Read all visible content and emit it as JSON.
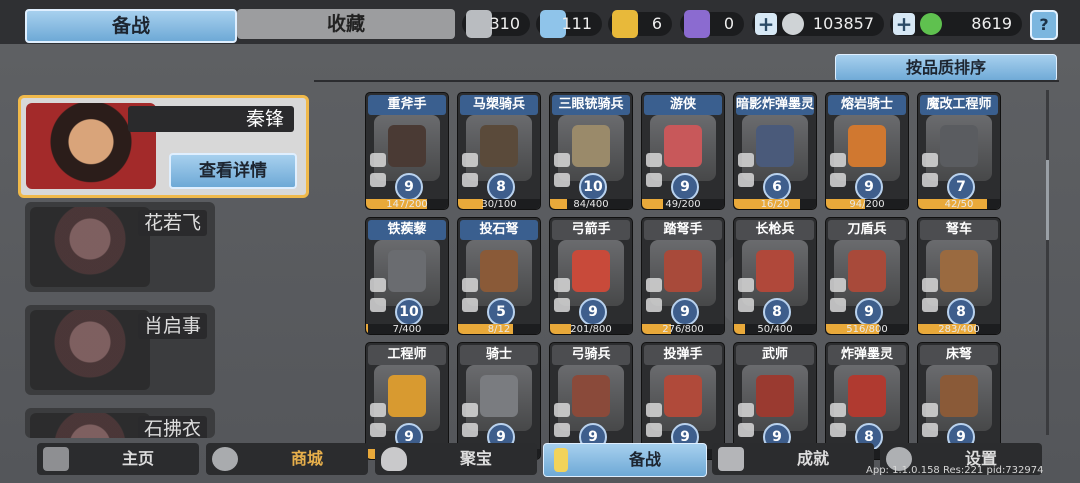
{
  "tabs": [
    {
      "label": "备战",
      "active": true
    },
    {
      "label": "收藏",
      "active": false
    }
  ],
  "resources": [
    {
      "icon": "silver-shield-icon",
      "value": "310",
      "color": "#b9bcc0"
    },
    {
      "icon": "crystal-icon",
      "value": "111",
      "color": "#8fc4ea"
    },
    {
      "icon": "gold-badge-icon",
      "value": "6",
      "color": "#e8b93a"
    },
    {
      "icon": "purple-badge-icon",
      "value": "0",
      "color": "#8b6bd0"
    },
    {
      "icon": "silver-coin-icon",
      "value": "103857",
      "color": "#cfd3d6"
    },
    {
      "icon": "green-gem-icon",
      "value": "8619",
      "color": "#5fc14f"
    }
  ],
  "help_label": "?",
  "sort_label": "按品质排序",
  "heroes": [
    {
      "name": "秦锋",
      "selected": true,
      "detail_label": "查看详情"
    },
    {
      "name": "花若飞"
    },
    {
      "name": "肖启事"
    },
    {
      "name": "石拂衣"
    }
  ],
  "units": [
    {
      "name": "重斧手",
      "level": "9",
      "progress": "147/200",
      "ratio": 0.735,
      "quality": "blue",
      "color": "#4a3a34"
    },
    {
      "name": "马槊骑兵",
      "level": "8",
      "progress": "30/100",
      "ratio": 0.3,
      "quality": "blue",
      "color": "#5a4a3a"
    },
    {
      "name": "三眼铳骑兵",
      "level": "10",
      "progress": "84/400",
      "ratio": 0.21,
      "quality": "blue",
      "color": "#9a8a6a"
    },
    {
      "name": "游侠",
      "level": "9",
      "progress": "49/200",
      "ratio": 0.245,
      "quality": "blue",
      "color": "#c8585a"
    },
    {
      "name": "暗影炸弹墨灵",
      "level": "6",
      "progress": "16/20",
      "ratio": 0.8,
      "quality": "blue",
      "color": "#4a5a7a"
    },
    {
      "name": "熔岩骑士",
      "level": "9",
      "progress": "94/200",
      "ratio": 0.47,
      "quality": "blue",
      "color": "#d07830"
    },
    {
      "name": "魔改工程师",
      "level": "7",
      "progress": "42/50",
      "ratio": 0.84,
      "quality": "blue",
      "color": "#5a5c60"
    },
    {
      "name": "铁蒺藜",
      "level": "10",
      "progress": "7/400",
      "ratio": 0.0175,
      "quality": "blue",
      "color": "#6a6c70"
    },
    {
      "name": "投石弩",
      "level": "5",
      "progress": "8/12",
      "ratio": 0.667,
      "quality": "blue",
      "color": "#8a5a38"
    },
    {
      "name": "弓箭手",
      "level": "9",
      "progress": "201/800",
      "ratio": 0.251,
      "quality": "gray",
      "color": "#c84a3a"
    },
    {
      "name": "踏弩手",
      "level": "9",
      "progress": "276/800",
      "ratio": 0.345,
      "quality": "gray",
      "color": "#a84a3a"
    },
    {
      "name": "长枪兵",
      "level": "8",
      "progress": "50/400",
      "ratio": 0.125,
      "quality": "gray",
      "color": "#b0483a"
    },
    {
      "name": "刀盾兵",
      "level": "9",
      "progress": "516/800",
      "ratio": 0.645,
      "quality": "gray",
      "color": "#a84a3a"
    },
    {
      "name": "弩车",
      "level": "8",
      "progress": "283/400",
      "ratio": 0.7075,
      "quality": "gray",
      "color": "#9a6a40"
    },
    {
      "name": "工程师",
      "level": "9",
      "progress": "",
      "ratio": 0.5,
      "quality": "gray",
      "color": "#d89a30"
    },
    {
      "name": "骑士",
      "level": "9",
      "progress": "",
      "ratio": 0.5,
      "quality": "gray",
      "color": "#7a7c80"
    },
    {
      "name": "弓骑兵",
      "level": "9",
      "progress": "",
      "ratio": 0.5,
      "quality": "gray",
      "color": "#8a4a3a"
    },
    {
      "name": "投弹手",
      "level": "9",
      "progress": "",
      "ratio": 0.5,
      "quality": "gray",
      "color": "#b04a3a"
    },
    {
      "name": "武师",
      "level": "9",
      "progress": "",
      "ratio": 0.5,
      "quality": "gray",
      "color": "#9a3a30"
    },
    {
      "name": "炸弹墨灵",
      "level": "8",
      "progress": "",
      "ratio": 0.5,
      "quality": "gray",
      "color": "#b03a30"
    },
    {
      "name": "床弩",
      "level": "9",
      "progress": "",
      "ratio": 0.5,
      "quality": "gray",
      "color": "#8a5a38"
    }
  ],
  "nav": [
    {
      "label": "主页",
      "icon": "castle-icon",
      "active": false
    },
    {
      "label": "商城",
      "icon": "coins-icon",
      "active": false,
      "highlight": true
    },
    {
      "label": "聚宝",
      "icon": "treasure-bowl-icon",
      "active": false
    },
    {
      "label": "备战",
      "icon": "card-icon",
      "active": true
    },
    {
      "label": "成就",
      "icon": "achievement-icon",
      "active": false
    },
    {
      "label": "设置",
      "icon": "gear-icon",
      "active": false
    }
  ],
  "version": "App: 1.1.0.158 Res:221 pid:732974"
}
